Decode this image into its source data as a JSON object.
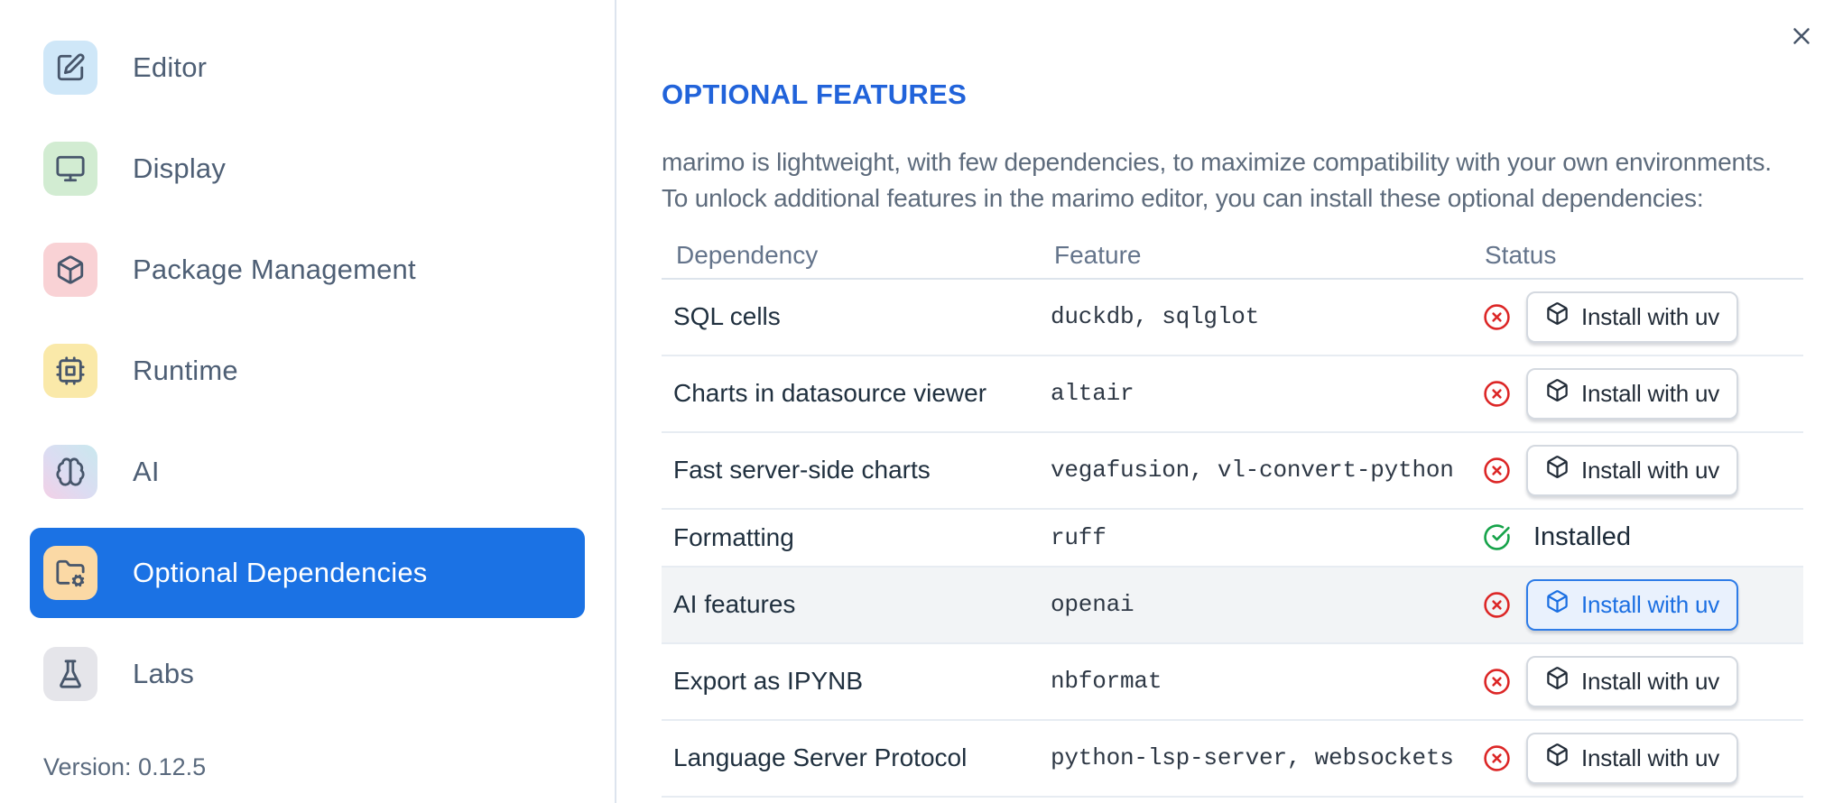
{
  "sidebar": {
    "items": [
      {
        "id": "editor",
        "label": "Editor",
        "icon": "square-pen",
        "bg": "#cfe7f8",
        "selected": false
      },
      {
        "id": "display",
        "label": "Display",
        "icon": "monitor",
        "bg": "#d2ecd2",
        "selected": false
      },
      {
        "id": "package-management",
        "label": "Package Management",
        "icon": "box",
        "bg": "#f9d2d5",
        "selected": false
      },
      {
        "id": "runtime",
        "label": "Runtime",
        "icon": "cpu",
        "bg": "#fae9a9",
        "selected": false
      },
      {
        "id": "ai",
        "label": "AI",
        "icon": "brain",
        "bg": "gradient-pink-blue",
        "selected": false
      },
      {
        "id": "optional-dependencies",
        "label": "Optional Dependencies",
        "icon": "folder-cog",
        "bg": "#fbd9a5",
        "selected": true
      },
      {
        "id": "labs",
        "label": "Labs",
        "icon": "flask",
        "bg": "#e5e5ea",
        "selected": false
      }
    ],
    "version_label": "Version: 0.12.5"
  },
  "dialog": {
    "title": "OPTIONAL FEATURES",
    "description": [
      "marimo is lightweight, with few dependencies, to maximize compatibility with your own environments.",
      "To unlock additional features in the marimo editor, you can install these optional dependencies:"
    ],
    "close_icon": "x"
  },
  "table": {
    "headers": [
      "Dependency",
      "Feature",
      "Status"
    ],
    "status_icons": {
      "not_installed": "circle-x",
      "installed": "circle-check"
    },
    "button_icon": "box",
    "rows": [
      {
        "dependency": "SQL cells",
        "feature": "duckdb, sqlglot",
        "installed": false,
        "action": "Install with uv",
        "focused": false,
        "hovered": false
      },
      {
        "dependency": "Charts in datasource viewer",
        "feature": "altair",
        "installed": false,
        "action": "Install with uv",
        "focused": false,
        "hovered": false
      },
      {
        "dependency": "Fast server-side charts",
        "feature": "vegafusion, vl-convert-python",
        "installed": false,
        "action": "Install with uv",
        "focused": false,
        "hovered": false
      },
      {
        "dependency": "Formatting",
        "feature": "ruff",
        "installed": true,
        "status_label": "Installed",
        "focused": false,
        "hovered": false
      },
      {
        "dependency": "AI features",
        "feature": "openai",
        "installed": false,
        "action": "Install with uv",
        "focused": true,
        "hovered": true
      },
      {
        "dependency": "Export as IPYNB",
        "feature": "nbformat",
        "installed": false,
        "action": "Install with uv",
        "focused": false,
        "hovered": false
      },
      {
        "dependency": "Language Server Protocol",
        "feature": "python-lsp-server, websockets",
        "installed": false,
        "action": "Install with uv",
        "focused": false,
        "hovered": false
      }
    ]
  },
  "colors": {
    "sidebar_selected_bg": "#1b72e4",
    "title_blue": "#2163da",
    "not_installed_red": "#dc2626",
    "installed_green": "#16a34a",
    "focused_button_border": "#2e7ce8",
    "focused_button_bg": "#e9f1fd",
    "focused_button_text": "#1b6fe2"
  }
}
